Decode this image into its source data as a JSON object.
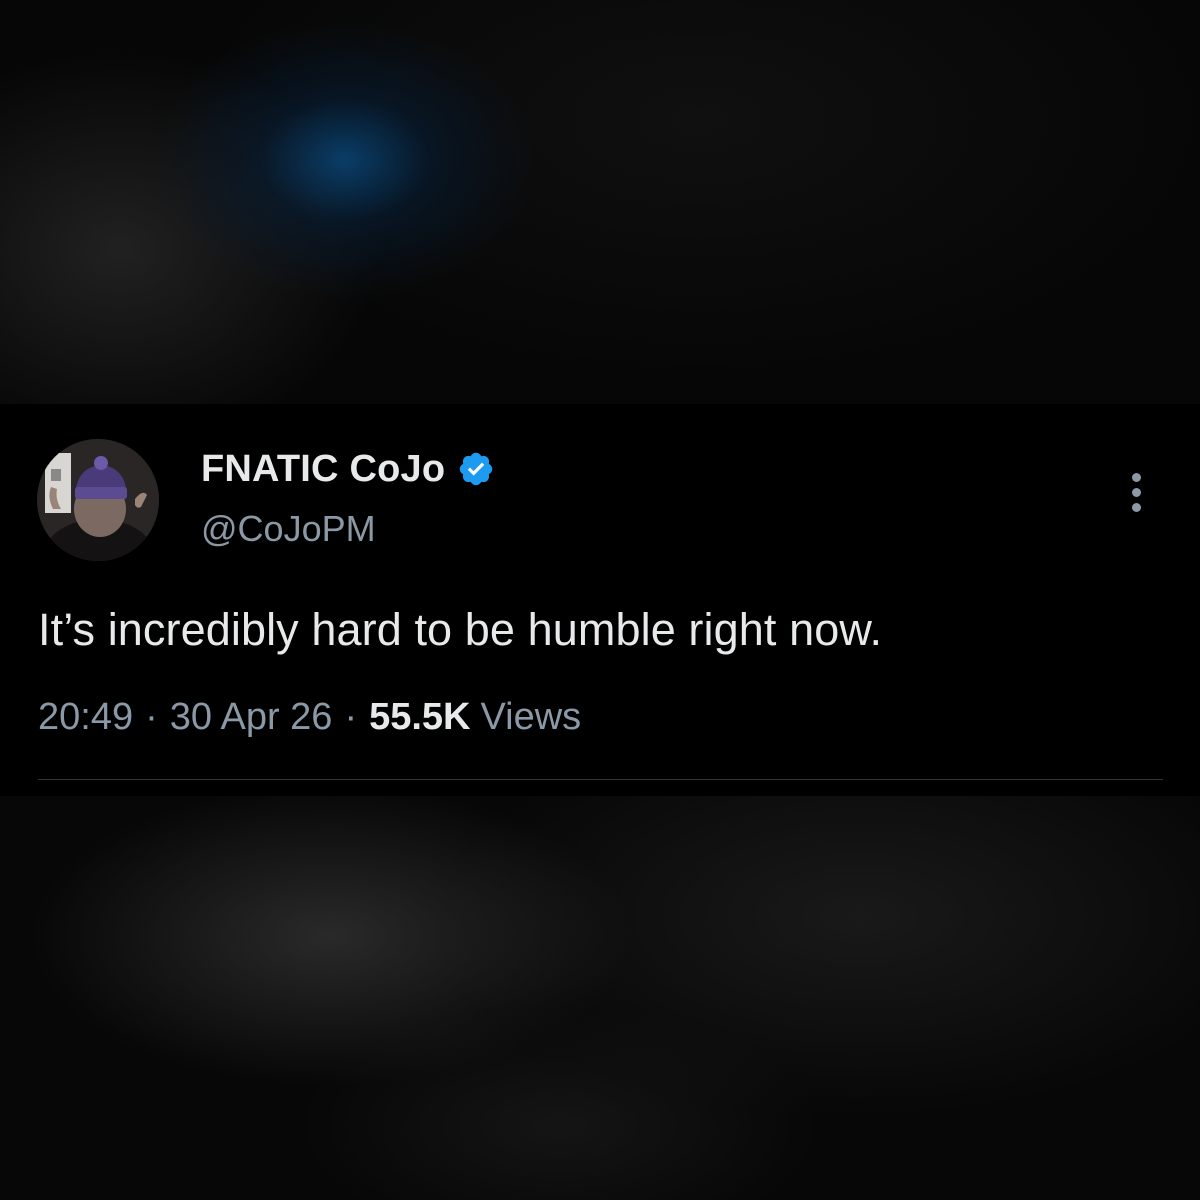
{
  "tweet": {
    "display_name": "FNATIC CoJo",
    "handle": "@CoJoPM",
    "verified": true,
    "text": "It’s incredibly hard to be humble right now.",
    "time": "20:49",
    "date": "30 Apr 26",
    "separator": "·",
    "views_count": "55.5K",
    "views_label": "Views"
  },
  "icons": {
    "verified": "verified-badge-icon",
    "more": "more-options-icon"
  },
  "colors": {
    "background": "#000000",
    "primary_text": "#e7e9ea",
    "secondary_text": "#8b98a5",
    "verified_blue": "#1d9bf0",
    "divider": "#2f3336"
  }
}
